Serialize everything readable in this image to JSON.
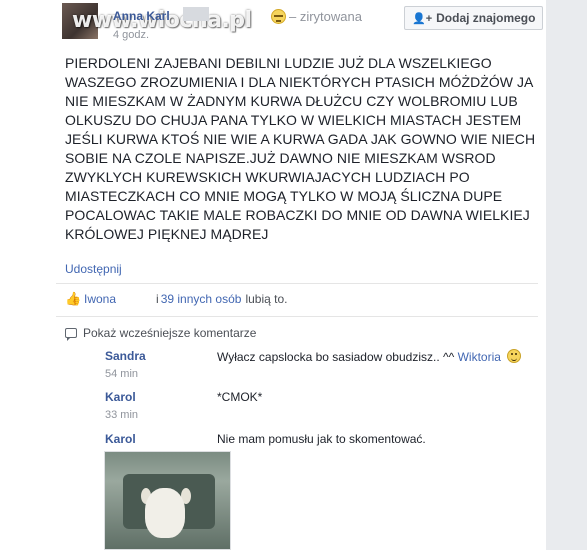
{
  "post": {
    "author": "Anna Karl",
    "timestamp": "4 godz.",
    "feeling": "– zirytowana",
    "feeling_icon": "annoyed-emoji-icon",
    "add_friend_label": "Dodaj znajomego",
    "watermark": "www.wiocha.pl",
    "body_lines": [
      "PIERDOLENI ZAJEBANI DEBILNI LUDZIE JUŻ DLA WSZELKIEGO",
      "WASZEGO ZROZUMIENIA I DLA NIEKTÓRYCH PTASICH MÓŻDŻÓW JA",
      "NIE MIESZKAM W ŻADNYM KURWA DŁUŻCU CZY WOLBROMIU LUB",
      "OLKUSZU DO CHUJA PANA TYLKO W WIELKICH MIASTACH JESTEM",
      "JEŚLI KURWA KTOŚ NIE WIE A KURWA GADA JAK GOWNO WIE NIECH",
      "SOBIE NA CZOLE NAPISZE.JUŻ DAWNO NIE MIESZKAM WSROD",
      "ZWYKLYCH KUREWSKICH WKURWIAJACYCH LUDZIACH PO",
      "MIASTECZKACH CO MNIE MOGĄ TYLKO W MOJĄ ŚLICZNA DUPE",
      "POCALOWAC TAKIE MALE ROBACZKI DO MNIE OD DAWNA WIELKIEJ",
      "KRÓLOWEJ PIĘKNEJ MĄDREJ"
    ],
    "share_label": "Udostępnij"
  },
  "likes": {
    "first_name": "Iwona",
    "separator": "i",
    "others": "39 innych osób",
    "suffix": "lubią to."
  },
  "comments_section": {
    "more_label": "Pokaż wcześniejsze komentarze",
    "items": [
      {
        "name": "Sandra",
        "text": "Wyłacz capslocka bo sasiadow obudzisz.. ^^",
        "sub": "Wiktoria",
        "time": "54 min"
      },
      {
        "name": "Karol",
        "text": "*CMOK*",
        "time": "33 min"
      },
      {
        "name": "Karol",
        "text": "Nie mam pomusłu jak to skomentować."
      }
    ]
  },
  "colors": {
    "link": "#3b5998",
    "accent": "#4267b2",
    "background": "#e9ebee"
  }
}
